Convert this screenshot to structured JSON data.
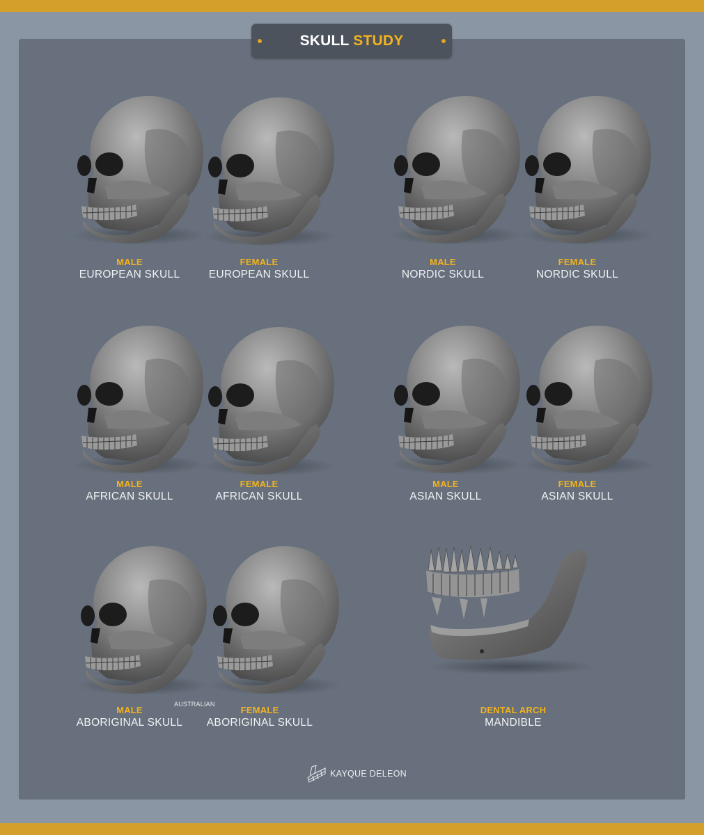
{
  "title": {
    "part1": "SKULL",
    "part2": "STUDY"
  },
  "colors": {
    "accent": "#f1b21f",
    "frame": "#d4a02b",
    "panel": "#67707c",
    "outer": "#8a96a3"
  },
  "items": [
    {
      "sub": "MALE",
      "main": "EUROPEAN SKULL"
    },
    {
      "sub": "FEMALE",
      "main": "EUROPEAN SKULL"
    },
    {
      "sub": "MALE",
      "main": "NORDIC SKULL"
    },
    {
      "sub": "FEMALE",
      "main": "NORDIC SKULL"
    },
    {
      "sub": "MALE",
      "main": "AFRICAN SKULL"
    },
    {
      "sub": "FEMALE",
      "main": "AFRICAN SKULL"
    },
    {
      "sub": "MALE",
      "main": "ASIAN SKULL"
    },
    {
      "sub": "FEMALE",
      "main": "ASIAN SKULL"
    },
    {
      "sub": "MALE",
      "main": "ABORIGINAL SKULL"
    },
    {
      "sub": "FEMALE",
      "main": "ABORIGINAL SKULL"
    },
    {
      "sub": "DENTAL ARCH",
      "main": "MANDIBLE"
    }
  ],
  "note": "AUSTRALIAN",
  "credit": {
    "text": "KAYQUE DELEON",
    "icon": "grid-logo-icon"
  }
}
